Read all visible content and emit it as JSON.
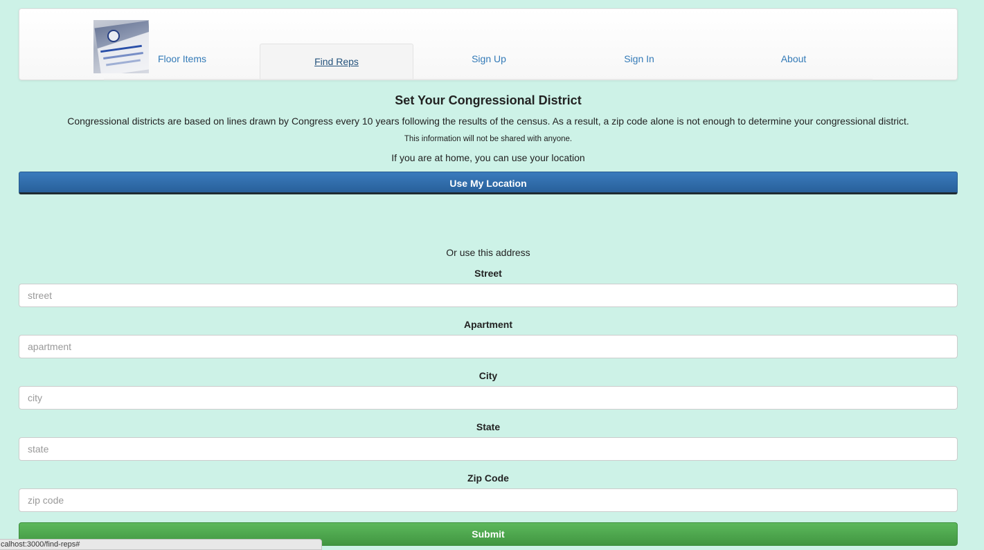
{
  "nav": {
    "items": [
      {
        "label": "Floor Items"
      },
      {
        "label": "Find Reps",
        "active": true
      },
      {
        "label": "Sign Up"
      },
      {
        "label": "Sign In"
      },
      {
        "label": "About"
      }
    ],
    "logo_icon": "ballot-drop-box-photo"
  },
  "main": {
    "title": "Set Your Congressional District",
    "description": "Congressional districts are based on lines drawn by Congress every 10 years following the results of the census. As a result, a zip code alone is not enough to determine your congressional district.",
    "privacy_note": "This information will not be shared with anyone.",
    "home_hint": "If you are at home, you can use your location",
    "location_button": "Use My Location",
    "or_text": "Or use this address",
    "fields": [
      {
        "label": "Street",
        "placeholder": "street",
        "value": ""
      },
      {
        "label": "Apartment",
        "placeholder": "apartment",
        "value": ""
      },
      {
        "label": "City",
        "placeholder": "city",
        "value": ""
      },
      {
        "label": "State",
        "placeholder": "state",
        "value": ""
      },
      {
        "label": "Zip Code",
        "placeholder": "zip code",
        "value": ""
      }
    ],
    "submit_button": "Submit"
  },
  "status_bar": {
    "url": "calhost:3000/find-reps#"
  },
  "colors": {
    "background": "#cdf2e7",
    "link": "#337ab7",
    "primary_button": "#337ab7",
    "success_button": "#5cb85c"
  }
}
